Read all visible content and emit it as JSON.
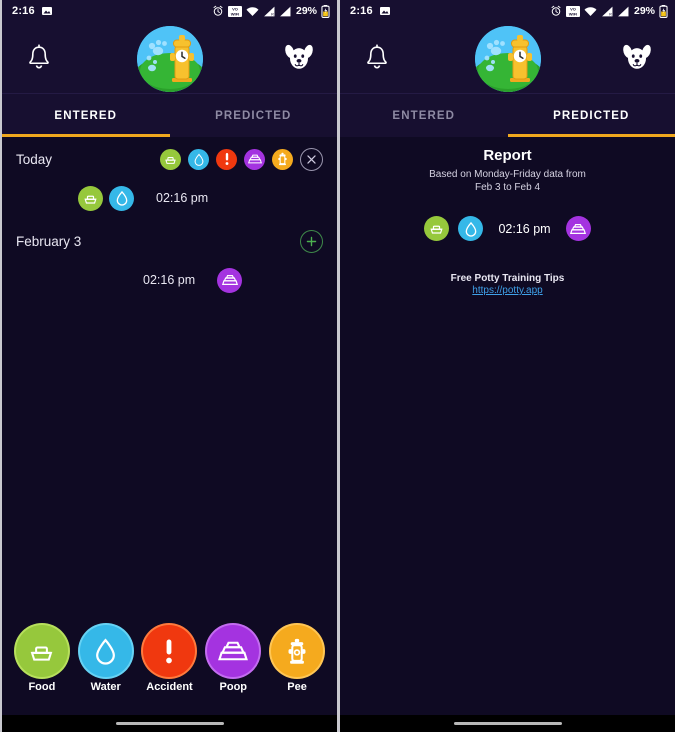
{
  "app": {
    "background_color": "#0f0a23",
    "surface_color": "#170f30",
    "accent_color": "#f0a81e"
  },
  "status_bar": {
    "time": "2:16",
    "battery_percent": "29%",
    "icons": [
      "image-icon",
      "alarm-icon",
      "vowifi-icon",
      "wifi-icon",
      "signal-icon",
      "signal-2-icon",
      "battery-icon"
    ]
  },
  "header": {
    "notification_icon": "bell-icon",
    "logo_icon": "hydrant-clock-logo",
    "dog_icon": "dog-face-icon"
  },
  "tabs": {
    "items": [
      {
        "label": "ENTERED"
      },
      {
        "label": "PREDICTED"
      }
    ],
    "left_panel_active_index": 0,
    "right_panel_active_index": 1
  },
  "categories": {
    "food": {
      "label": "Food",
      "color": "#96c83c",
      "icon": "food-bowl-icon"
    },
    "water": {
      "label": "Water",
      "color": "#35b8e8",
      "icon": "water-drop-icon"
    },
    "accident": {
      "label": "Accident",
      "color": "#f0380f",
      "icon": "exclamation-icon"
    },
    "poop": {
      "label": "Poop",
      "color": "#a433e0",
      "icon": "poop-icon"
    },
    "pee": {
      "label": "Pee",
      "color": "#f5aa1e",
      "icon": "hydrant-icon"
    }
  },
  "entered": {
    "groups": [
      {
        "title": "Today",
        "filter_icons": [
          "food",
          "water",
          "accident",
          "poop",
          "pee"
        ],
        "action_icon": "close-icon",
        "action_name": "clear-filters-button",
        "entries": [
          {
            "icons": [
              "food",
              "water"
            ],
            "time": "02:16 pm",
            "icons_before_time": true
          }
        ]
      },
      {
        "title": "February 3",
        "filter_icons": [],
        "action_icon": "plus-icon",
        "action_name": "add-entry-button",
        "entries": [
          {
            "icons": [
              "poop"
            ],
            "time": "02:16 pm",
            "icons_before_time": false
          }
        ]
      }
    ]
  },
  "predicted": {
    "title": "Report",
    "subtitle_line1": "Based on Monday-Friday data from",
    "subtitle_line2": "Feb 3 to Feb 4",
    "row": {
      "leading_icons": [
        "food",
        "water"
      ],
      "time": "02:16 pm",
      "trailing_icons": [
        "poop"
      ]
    },
    "tips_label": "Free Potty Training Tips",
    "tips_url": "https://potty.app"
  },
  "quick_bar": {
    "items": [
      {
        "key": "food",
        "label": "Food"
      },
      {
        "key": "water",
        "label": "Water"
      },
      {
        "key": "accident",
        "label": "Accident"
      },
      {
        "key": "poop",
        "label": "Poop"
      },
      {
        "key": "pee",
        "label": "Pee"
      }
    ]
  }
}
